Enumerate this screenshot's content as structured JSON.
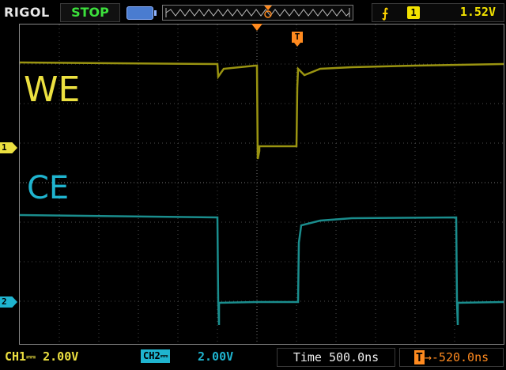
{
  "header": {
    "brand": "RIGOL",
    "run_status": "STOP",
    "trigger": {
      "edge_icon": "rising-edge-icon",
      "source_channel": "1",
      "level": "1.52V"
    }
  },
  "display": {
    "channel_labels": {
      "we": "WE",
      "ce": "CE"
    },
    "ch1_marker": "1",
    "ch2_marker": "2",
    "trigger_marker": "T"
  },
  "footer": {
    "ch1_label": "CH1",
    "ch1_scale": "2.00V",
    "ch2_label": "CH2",
    "ch2_scale": "2.00V",
    "timebase": "Time 500.0ns",
    "trigger_offset": "-520.0ns"
  },
  "colors": {
    "ch1": "#ece040",
    "ch2": "#1fb4cf",
    "trigger": "#ff8a1f",
    "status_ok": "#3ce13c"
  }
}
